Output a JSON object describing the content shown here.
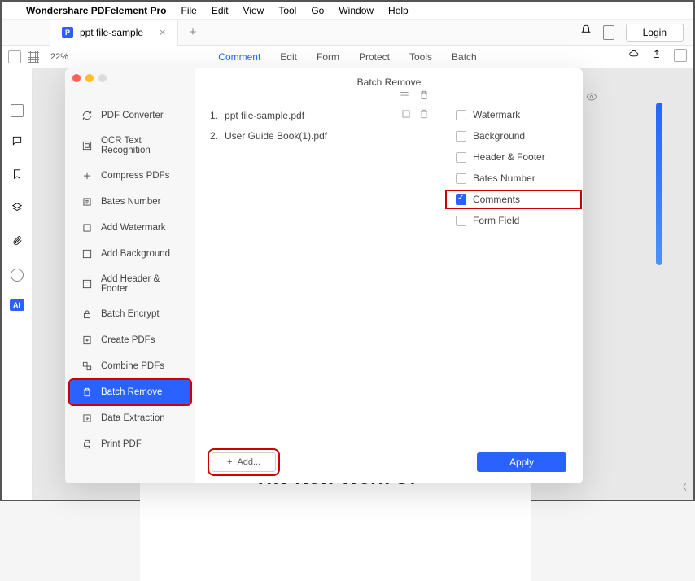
{
  "menubar": {
    "appname": "Wondershare PDFelement Pro",
    "items": [
      "File",
      "Edit",
      "View",
      "Tool",
      "Go",
      "Window",
      "Help"
    ]
  },
  "tabbar": {
    "tab_title": "ppt file-sample",
    "login_label": "Login"
  },
  "toolbar": {
    "zoom": "22%",
    "menu": [
      "Comment",
      "Edit",
      "Form",
      "Protect",
      "Tools",
      "Batch"
    ]
  },
  "modal": {
    "title": "Batch Remove",
    "sidebar": [
      {
        "label": "PDF Converter",
        "icon": "refresh"
      },
      {
        "label": "OCR Text Recognition",
        "icon": "ocr"
      },
      {
        "label": "Compress PDFs",
        "icon": "compress"
      },
      {
        "label": "Bates Number",
        "icon": "bates"
      },
      {
        "label": "Add Watermark",
        "icon": "watermark"
      },
      {
        "label": "Add Background",
        "icon": "background"
      },
      {
        "label": "Add Header & Footer",
        "icon": "header"
      },
      {
        "label": "Batch Encrypt",
        "icon": "lock"
      },
      {
        "label": "Create PDFs",
        "icon": "create"
      },
      {
        "label": "Combine PDFs",
        "icon": "combine"
      },
      {
        "label": "Batch Remove",
        "icon": "trash",
        "selected": true,
        "highlighted": true
      },
      {
        "label": "Data Extraction",
        "icon": "extract"
      },
      {
        "label": "Print PDF",
        "icon": "print"
      }
    ],
    "files": [
      {
        "num": "1.",
        "name": "ppt file-sample.pdf"
      },
      {
        "num": "2.",
        "name": "User Guide Book(1).pdf"
      }
    ],
    "options": [
      {
        "label": "Watermark",
        "checked": false
      },
      {
        "label": "Background",
        "checked": false
      },
      {
        "label": "Header & Footer",
        "checked": false
      },
      {
        "label": "Bates Number",
        "checked": false
      },
      {
        "label": "Comments",
        "checked": true,
        "highlighted": true
      },
      {
        "label": "Form Field",
        "checked": false
      }
    ],
    "add_label": "Add...",
    "apply_label": "Apply"
  },
  "background_doc": {
    "line1": "The New Work Of"
  }
}
